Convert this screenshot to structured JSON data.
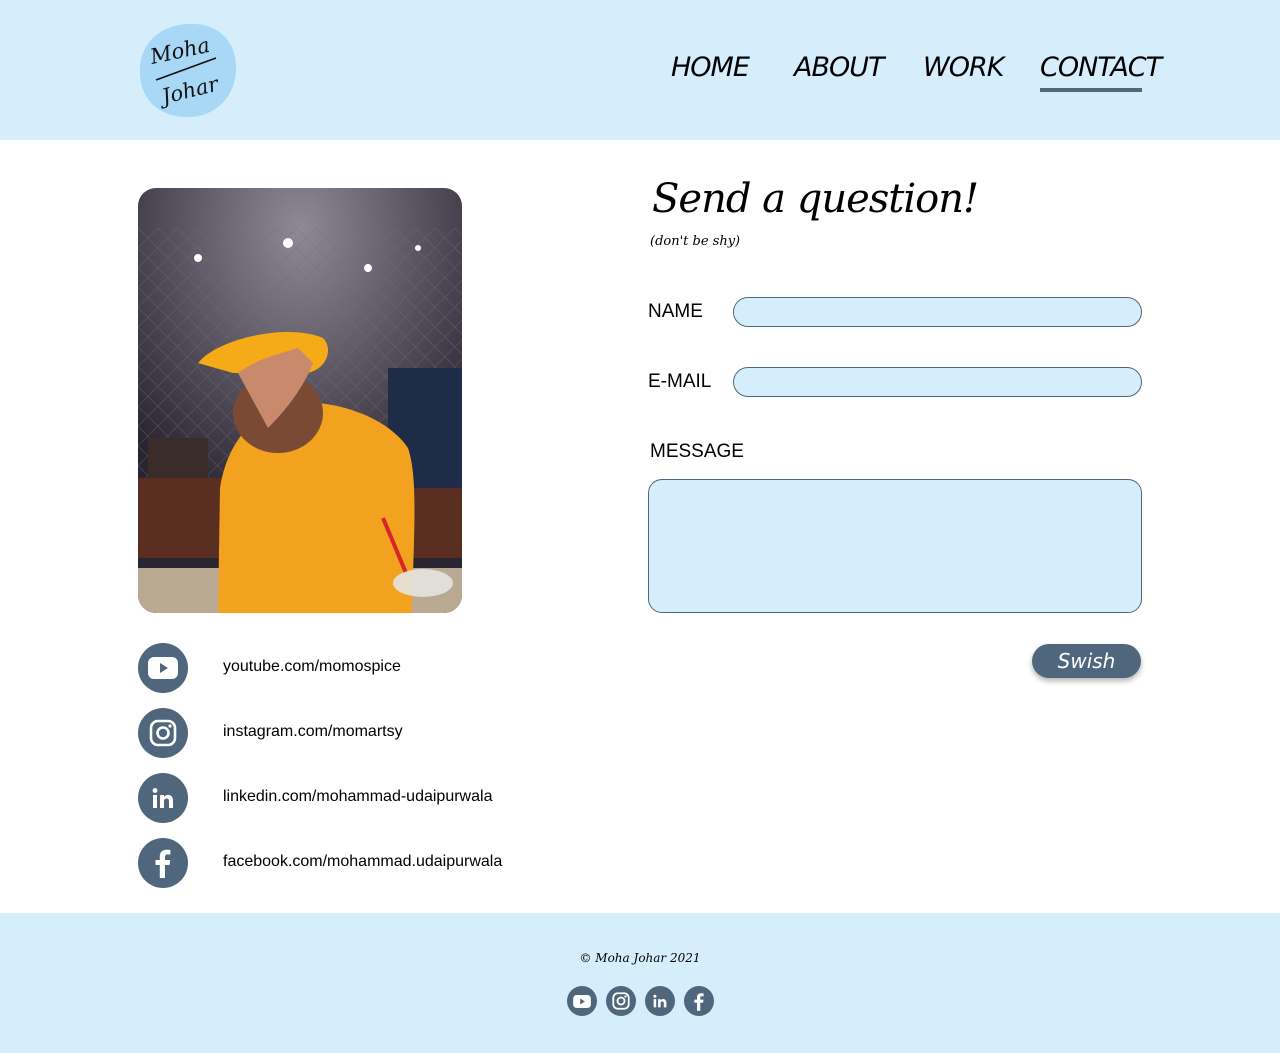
{
  "header": {
    "logo_text_line1": "Moha",
    "logo_text_line2": "Johar",
    "nav": [
      {
        "label": "HOME"
      },
      {
        "label": "ABOUT"
      },
      {
        "label": "WORK"
      },
      {
        "label": "CONTACT",
        "active": true
      }
    ]
  },
  "profile": {
    "photo_icon": "person-photo"
  },
  "social": [
    {
      "icon": "youtube-icon",
      "text": "youtube.com/momospice"
    },
    {
      "icon": "instagram-icon",
      "text": "instagram.com/momartsy"
    },
    {
      "icon": "linkedin-icon",
      "text": "linkedin.com/mohammad-udaipurwala"
    },
    {
      "icon": "facebook-icon",
      "text": "facebook.com/mohammad.udaipurwala"
    }
  ],
  "form": {
    "title": "Send a question!",
    "subtitle": "(don't be shy)",
    "name_label": "NAME",
    "name_value": "",
    "email_label": "E-MAIL",
    "email_value": "",
    "message_label": "MESSAGE",
    "message_value": "",
    "submit_label": "Swish"
  },
  "footer": {
    "copyright": "© Moha Johar 2021",
    "icons": [
      "youtube-icon",
      "instagram-icon",
      "linkedin-icon",
      "facebook-icon"
    ]
  },
  "colors": {
    "light_blue": "#d6eefb",
    "slate": "#4f667c",
    "logo_blue": "#a9d8f7"
  }
}
